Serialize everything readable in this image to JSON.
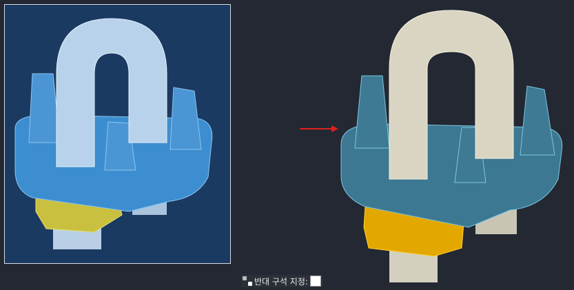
{
  "command_prompt": {
    "icon": "corner-select-icon",
    "text": "반대 구석 지정:",
    "input_value": ""
  },
  "colors": {
    "viewport_bg": "#232832",
    "selection_bg": "#1b3a62",
    "arrow": "#e02020",
    "plate": "#3f7894",
    "nut": "#e0a800",
    "ubolt": "#d6d2c0"
  }
}
